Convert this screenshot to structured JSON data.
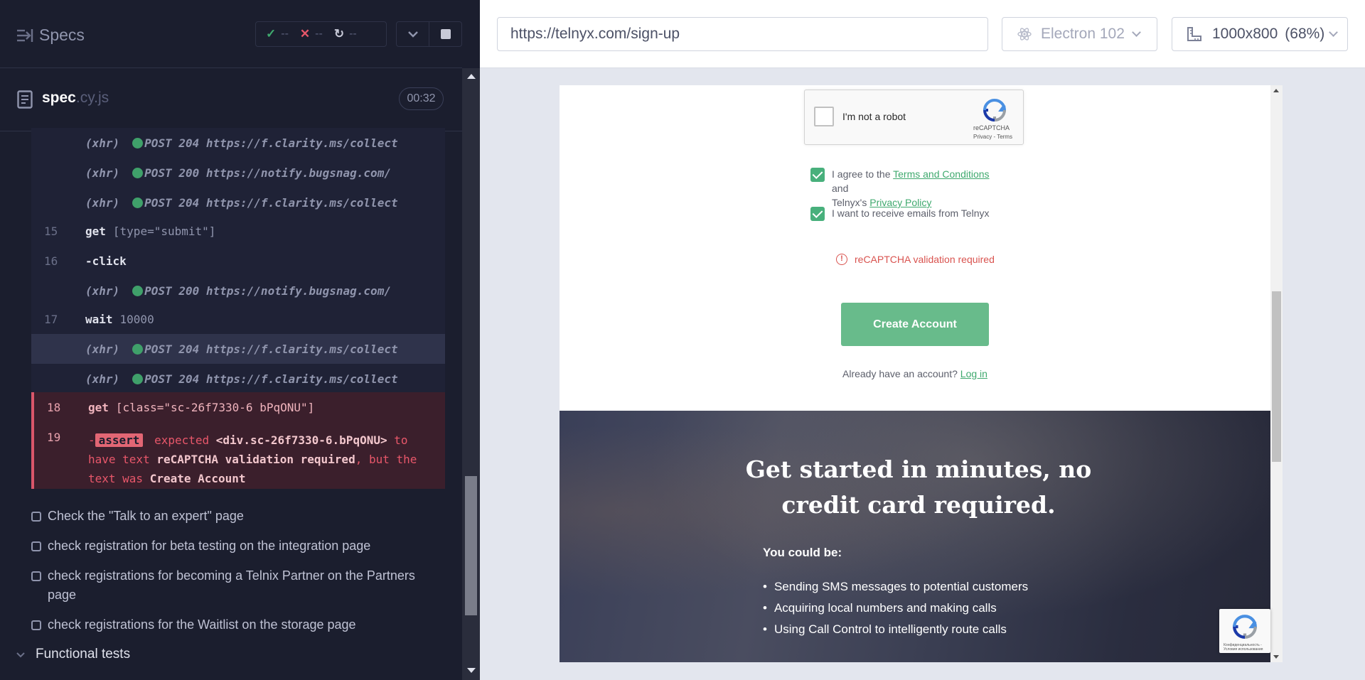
{
  "reporter": {
    "title": "Specs",
    "stats": {
      "passed": "--",
      "failed": "--",
      "pending": "--"
    },
    "spec": {
      "name": "spec",
      "ext": ".cy.js",
      "duration": "00:32"
    },
    "commands": [
      {
        "num": "",
        "kind": "xhr",
        "label": "(xhr)",
        "text": "POST 204 https://f.clarity.ms/collect"
      },
      {
        "num": "",
        "kind": "xhr",
        "label": "(xhr)",
        "text": "POST 200 https://notify.bugsnag.com/"
      },
      {
        "num": "",
        "kind": "xhr",
        "label": "(xhr)",
        "text": "POST 204 https://f.clarity.ms/collect"
      },
      {
        "num": "15",
        "kind": "cmd",
        "name": "get",
        "arg": "[type=\"submit\"]"
      },
      {
        "num": "16",
        "kind": "cmd",
        "name": "-click",
        "arg": ""
      },
      {
        "num": "",
        "kind": "xhr",
        "label": "(xhr)",
        "text": "POST 200 https://notify.bugsnag.com/"
      },
      {
        "num": "17",
        "kind": "cmd",
        "name": "wait",
        "arg": "10000"
      },
      {
        "num": "",
        "kind": "xhr",
        "label": "(xhr)",
        "text": "POST 204 https://f.clarity.ms/collect"
      },
      {
        "num": "",
        "kind": "xhr",
        "label": "(xhr)",
        "text": "POST 204 https://f.clarity.ms/collect"
      },
      {
        "num": "18",
        "kind": "err",
        "name": "get",
        "arg": "[class=\"sc-26f7330-6 bPqONU\"]"
      }
    ],
    "assert_cmd": {
      "num": "19",
      "dash": "-",
      "badge": "assert",
      "expected": "expected",
      "subject": "<div.sc-26f7330-6.bPqONU>",
      "to": "to",
      "have_text": "have text",
      "expected_text": "reCAPTCHA validation required",
      "but": ", but the",
      "text_was": "text was",
      "actual_text": "Create Account"
    },
    "tests": [
      "Check the \"Talk to an expert\" page",
      "check registration for beta testing on the integration page",
      "check registrations for becoming a Telnix Partner on the Partners page",
      "check registrations for the Waitlist on the storage page"
    ],
    "suite": "Functional tests"
  },
  "topbar": {
    "url": "https://telnyx.com/sign-up",
    "browser": "Electron 102",
    "viewport": "1000x800",
    "zoom": "(68%)"
  },
  "app": {
    "captcha": {
      "label": "I'm not a robot",
      "brand": "reCAPTCHA",
      "links": "Privacy - Terms"
    },
    "agree_terms": {
      "prefix": "I agree to the ",
      "terms_link": "Terms and Conditions",
      "mid": " and",
      "line2": "Telnyx's ",
      "privacy_link": "Privacy Policy"
    },
    "agree_emails": "I want to receive emails from Telnyx",
    "error": "reCAPTCHA validation required",
    "create_button": "Create Account",
    "already": "Already have an account?",
    "login_link": "Log in",
    "hero": {
      "title": "Get started in minutes, no credit card required.",
      "subtitle": "You could be:",
      "items": [
        "Sending SMS messages to potential customers",
        "Acquiring local numbers and making calls",
        "Using Call Control to intelligently route calls"
      ]
    },
    "badge_text": "Конфиденциальность - Условия использования"
  },
  "colors": {
    "accent_green": "#48b07c",
    "error_red": "#d9534f",
    "reporter_bg": "#1b1e2e"
  }
}
